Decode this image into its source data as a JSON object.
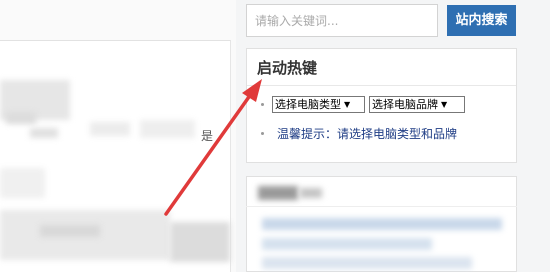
{
  "article": {
    "fragment": "是"
  },
  "search": {
    "placeholder": "请输入关键词...",
    "button_label": "站内搜索"
  },
  "hotkey_widget": {
    "title": "启动热键",
    "computer_type_select": "选择电脑类型",
    "computer_brand_select": "选择电脑品牌",
    "tip": "温馨提示：请选择电脑类型和品牌"
  },
  "colors": {
    "search_button": "#2e6fb2",
    "tip_text": "#1f3d85",
    "annotation_arrow": "#e03a3a"
  }
}
